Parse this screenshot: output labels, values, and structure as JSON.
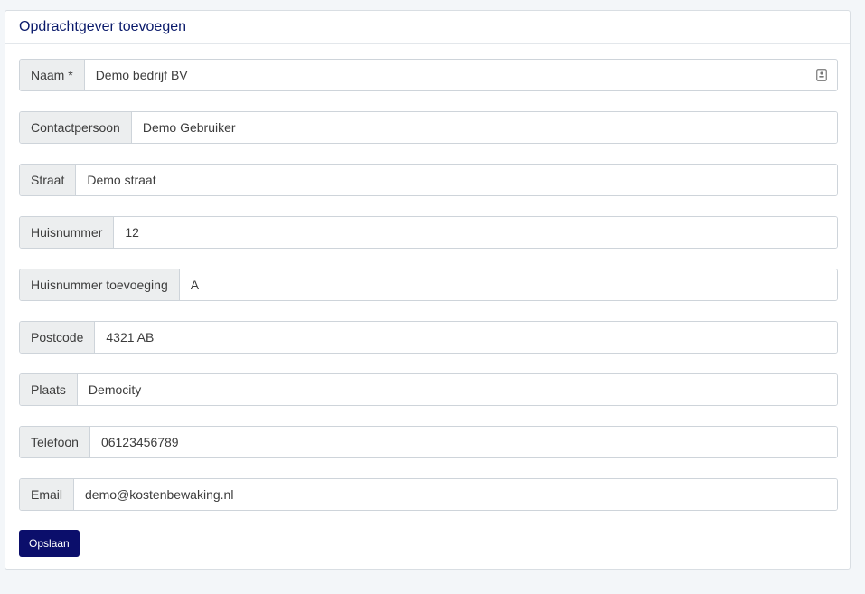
{
  "card": {
    "title": "Opdrachtgever toevoegen"
  },
  "form": {
    "fields": [
      {
        "label": "Naam *",
        "value": "Demo bedrijf BV"
      },
      {
        "label": "Contactpersoon",
        "value": "Demo Gebruiker"
      },
      {
        "label": "Straat",
        "value": "Demo straat"
      },
      {
        "label": "Huisnummer",
        "value": "12"
      },
      {
        "label": "Huisnummer toevoeging",
        "value": "A"
      },
      {
        "label": "Postcode",
        "value": "4321 AB"
      },
      {
        "label": "Plaats",
        "value": "Democity"
      },
      {
        "label": "Telefoon",
        "value": "06123456789"
      },
      {
        "label": "Email",
        "value": "demo@kostenbewaking.nl"
      }
    ],
    "name_field_icon": "contact-card-icon",
    "save_label": "Opslaan"
  },
  "colors": {
    "title": "#0a1a6b",
    "button": "#0b0e6b",
    "addon_bg": "#eceeef"
  }
}
